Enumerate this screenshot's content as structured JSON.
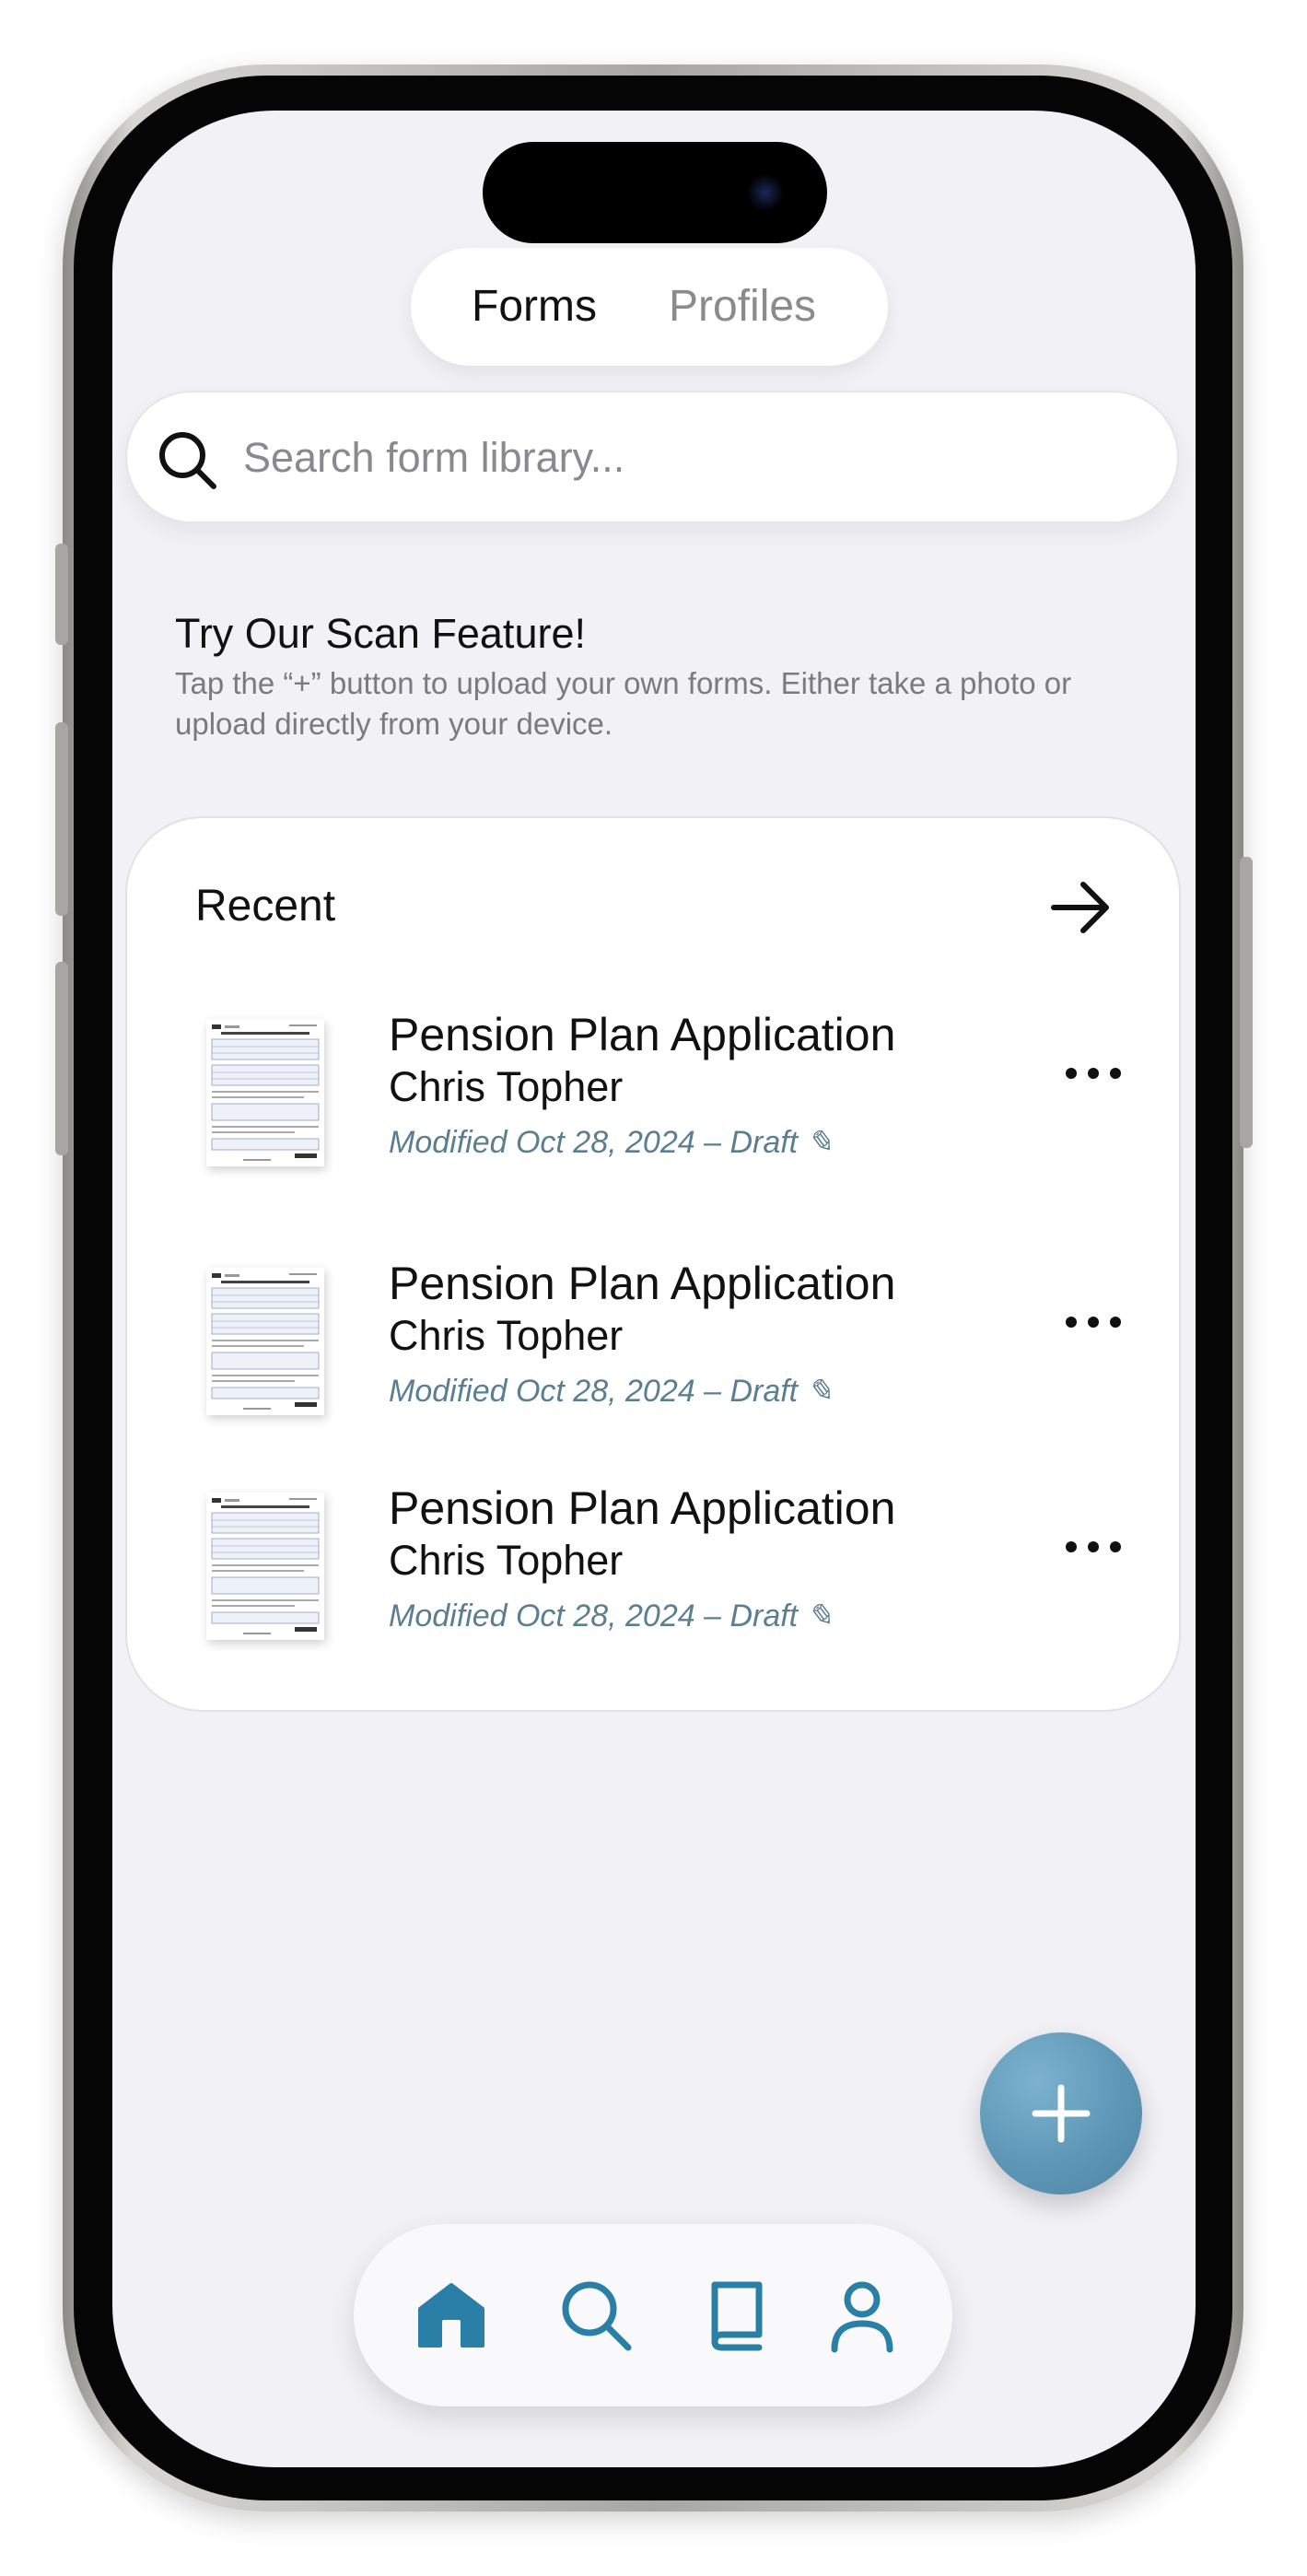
{
  "segmented": {
    "tabs": [
      "Forms",
      "Profiles"
    ],
    "active": "Forms"
  },
  "search": {
    "placeholder": "Search form library..."
  },
  "promo": {
    "title": "Try Our Scan Feature!",
    "body": "Tap the “+” button to upload your own forms. Either take a photo or upload directly from your device."
  },
  "recent": {
    "title": "Recent",
    "items": [
      {
        "title": "Pension Plan Application",
        "person": "Chris Topher",
        "meta": "Modified Oct 28, 2024 – Draft ✎"
      },
      {
        "title": "Pension Plan Application",
        "person": "Chris Topher",
        "meta": "Modified Oct 28, 2024 – Draft ✎"
      },
      {
        "title": "Pension Plan Application",
        "person": "Chris Topher",
        "meta": "Modified Oct 28, 2024 – Draft ✎"
      }
    ]
  },
  "fab": {
    "icon": "plus-icon"
  },
  "tabbar": {
    "items": [
      "home-icon",
      "search-icon",
      "library-icon",
      "profile-icon"
    ],
    "active": "home-icon"
  },
  "colors": {
    "accent": "#2a7fa6",
    "fab": "#5e97b6",
    "meta": "#5b7f91",
    "background": "#f1f1f6"
  }
}
